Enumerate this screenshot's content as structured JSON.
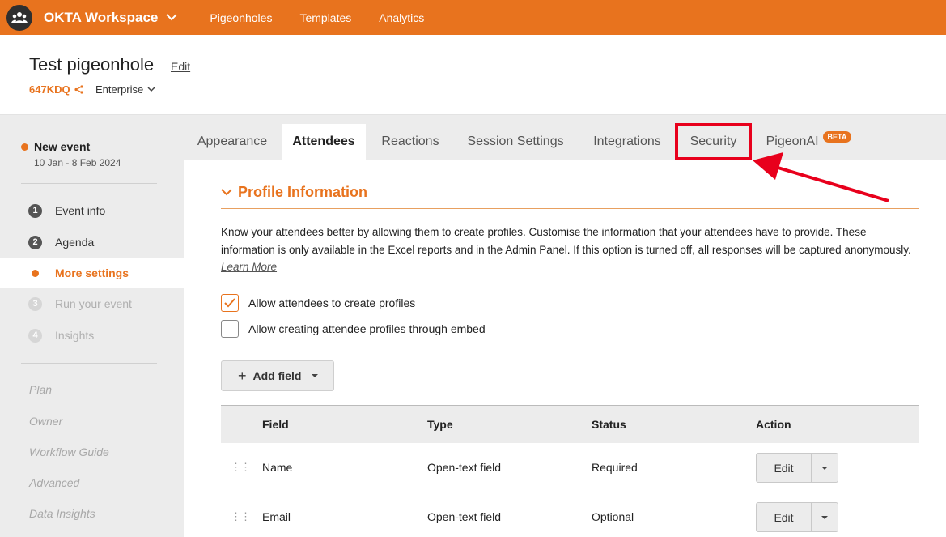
{
  "topbar": {
    "workspace": "OKTA Workspace",
    "nav": [
      "Pigeonholes",
      "Templates",
      "Analytics"
    ]
  },
  "header": {
    "title": "Test pigeonhole",
    "edit_label": "Edit",
    "code": "647KDQ",
    "plan": "Enterprise"
  },
  "sidebar": {
    "event_name": "New event",
    "event_dates": "10 Jan - 8 Feb 2024",
    "steps": [
      {
        "num": "1",
        "label": "Event info"
      },
      {
        "num": "2",
        "label": "Agenda"
      },
      {
        "num": "",
        "label": "More settings"
      },
      {
        "num": "3",
        "label": "Run your event"
      },
      {
        "num": "4",
        "label": "Insights"
      }
    ],
    "links": [
      "Plan",
      "Owner",
      "Workflow Guide",
      "Advanced",
      "Data Insights"
    ]
  },
  "tabs": {
    "items": [
      "Appearance",
      "Attendees",
      "Reactions",
      "Session Settings",
      "Integrations",
      "Security",
      "PigeonAI"
    ],
    "beta": "BETA"
  },
  "section": {
    "title": "Profile Information",
    "description": "Know your attendees better by allowing them to create profiles. Customise the information that your attendees have to provide. These information is only available in the Excel reports and in the Admin Panel. If this option is turned off, all responses will be captured anonymously.",
    "learn_more": "Learn More",
    "check1": "Allow attendees to create profiles",
    "check2": "Allow creating attendee profiles through embed",
    "add_field": "Add field"
  },
  "table": {
    "headers": [
      "Field",
      "Type",
      "Status",
      "Action"
    ],
    "rows": [
      {
        "field": "Name",
        "type": "Open-text field",
        "status": "Required",
        "action": "Edit"
      },
      {
        "field": "Email",
        "type": "Open-text field",
        "status": "Optional",
        "action": "Edit"
      }
    ]
  },
  "colors": {
    "brand": "#e8731e",
    "highlight": "#e8001c"
  }
}
